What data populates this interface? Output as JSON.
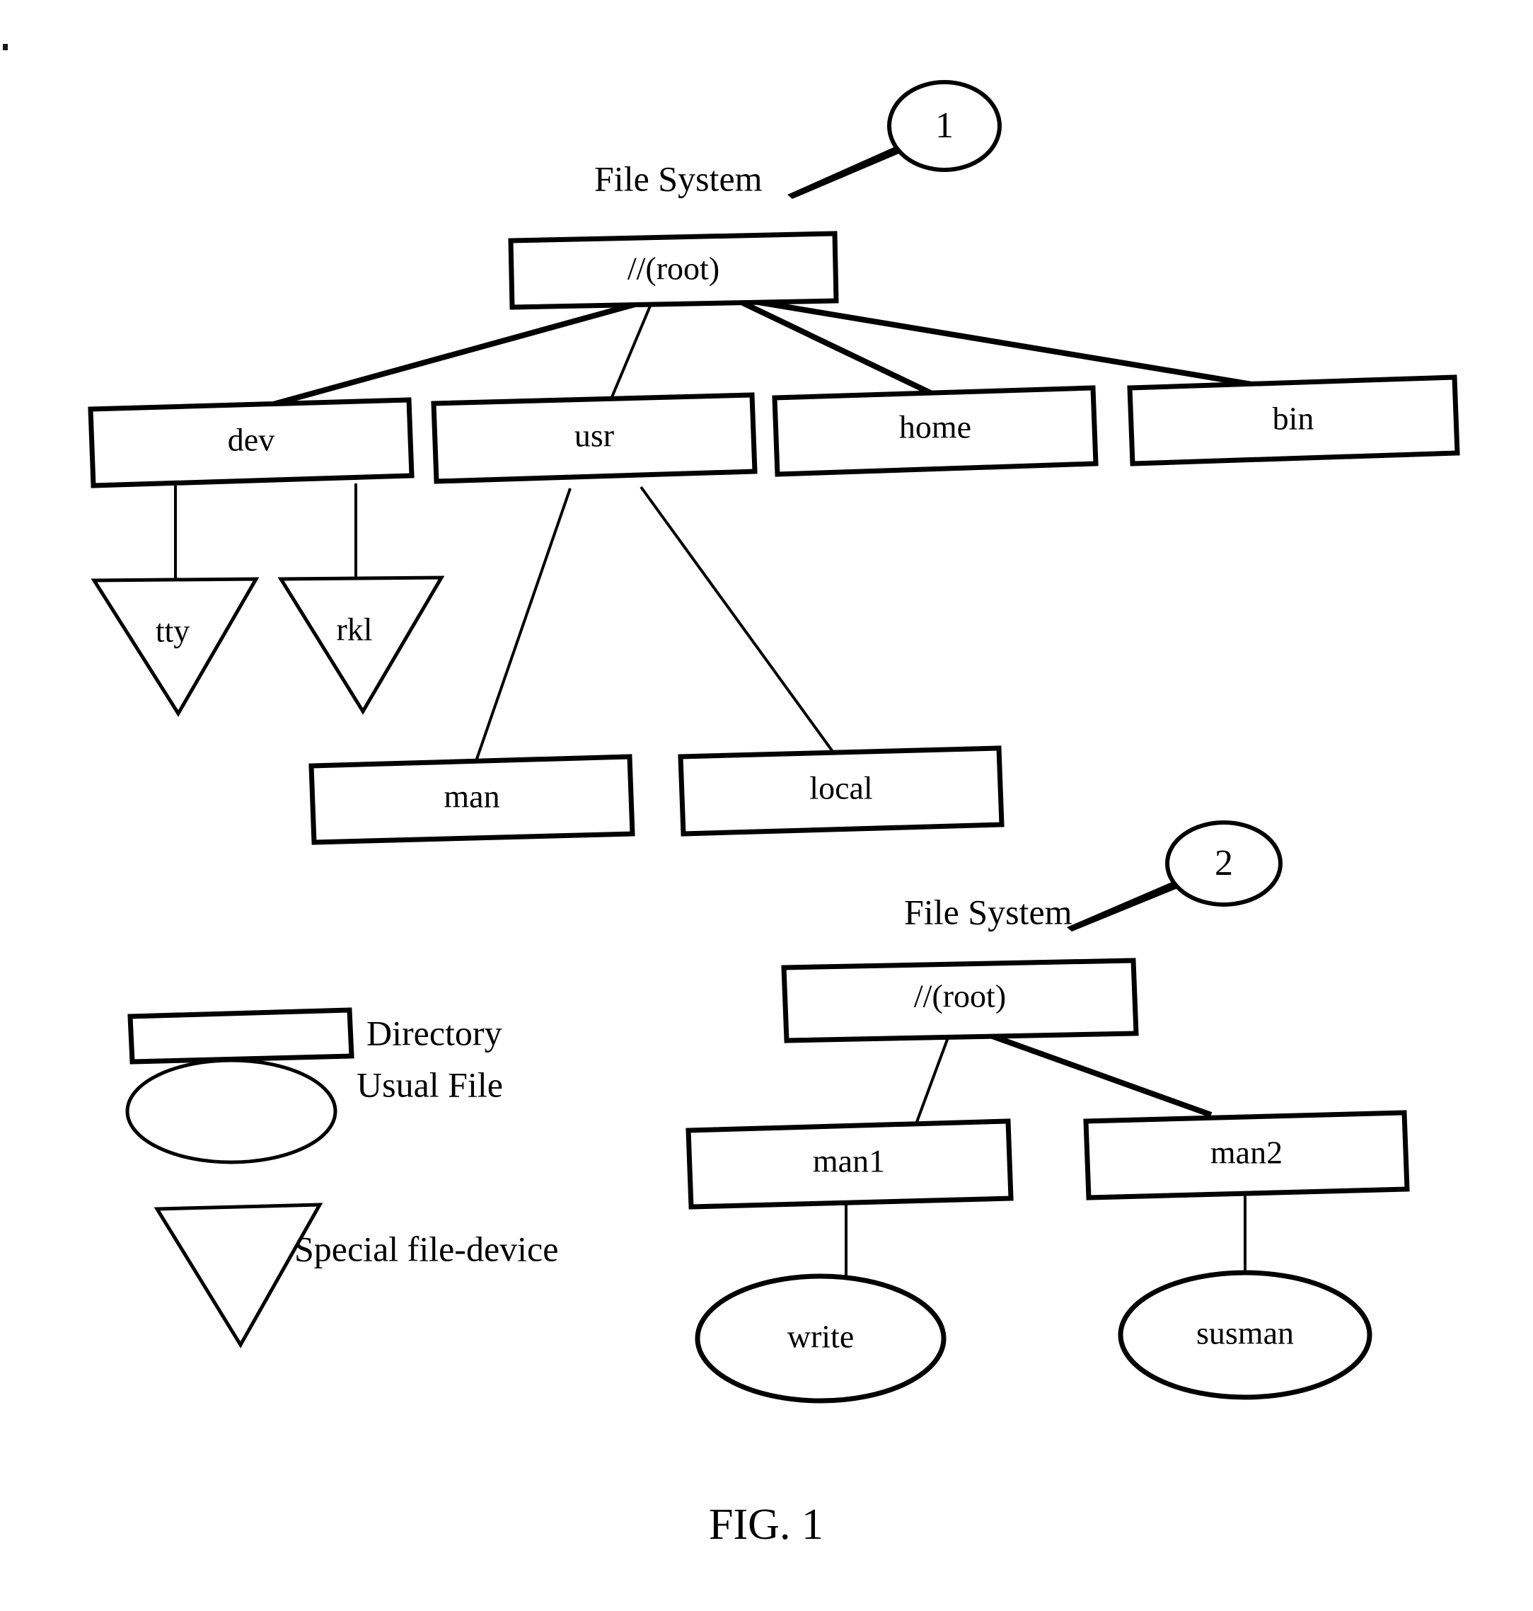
{
  "figure": {
    "caption": "FIG. 1"
  },
  "callouts": [
    {
      "id": "callout-1",
      "number": "1",
      "label": "File System"
    },
    {
      "id": "callout-2",
      "number": "2",
      "label": "File System"
    }
  ],
  "tree_one": {
    "root": {
      "label": "//(root)",
      "shape": "rectangle"
    },
    "level_two": [
      {
        "label": "dev",
        "shape": "rectangle"
      },
      {
        "label": "usr",
        "shape": "rectangle"
      },
      {
        "label": "home",
        "shape": "rectangle"
      },
      {
        "label": "bin",
        "shape": "rectangle"
      }
    ],
    "dev_children": [
      {
        "label": "tty",
        "shape": "triangle"
      },
      {
        "label": "rkl",
        "shape": "triangle"
      }
    ],
    "usr_children": [
      {
        "label": "man",
        "shape": "rectangle"
      },
      {
        "label": "local",
        "shape": "rectangle"
      }
    ]
  },
  "tree_two": {
    "root": {
      "label": "//(root)",
      "shape": "rectangle"
    },
    "level_two": [
      {
        "label": "man1",
        "shape": "rectangle"
      },
      {
        "label": "man2",
        "shape": "rectangle"
      }
    ],
    "leaves": [
      {
        "label": "write",
        "shape": "ellipse"
      },
      {
        "label": "susman",
        "shape": "ellipse"
      }
    ]
  },
  "legend": {
    "items": [
      {
        "shape": "rectangle",
        "label": "Directory"
      },
      {
        "shape": "ellipse",
        "label": "Usual File"
      },
      {
        "shape": "triangle",
        "label": "Special file-device"
      }
    ]
  },
  "colors": {
    "ink": "#000000",
    "paper": "#ffffff"
  }
}
